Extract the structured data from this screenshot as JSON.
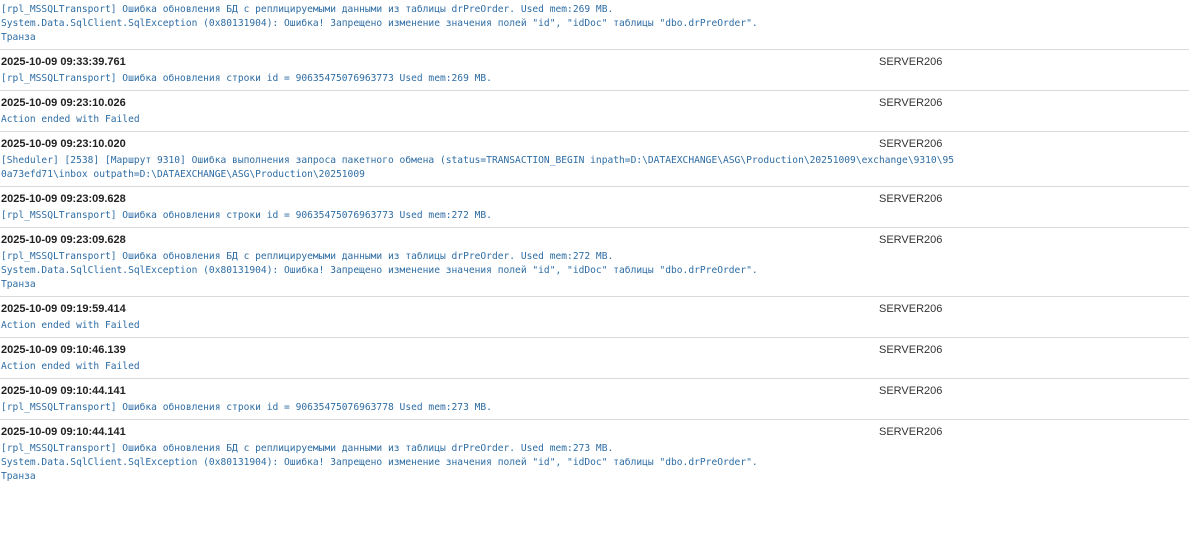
{
  "entries": [
    {
      "timestamp": "",
      "server": "",
      "lines": [
        "[rpl_MSSQLTransport] Ошибка обновления БД с реплицируемыми данными из таблицы drPreOrder. Used mem:269 MB.",
        "System.Data.SqlClient.SqlException (0x80131904): Ошибка! Запрещено изменение значения полей \"id\", \"idDoc\" таблицы \"dbo.drPreOrder\".",
        "Транза"
      ]
    },
    {
      "timestamp": "2025-10-09 09:33:39.761",
      "server": "SERVER206",
      "lines": [
        "[rpl_MSSQLTransport] Ошибка обновления строки id = 90635475076963773 Used mem:269 MB."
      ]
    },
    {
      "timestamp": "2025-10-09 09:23:10.026",
      "server": "SERVER206",
      "lines": [
        "Action ended with Failed"
      ]
    },
    {
      "timestamp": "2025-10-09 09:23:10.020",
      "server": "SERVER206",
      "lines": [
        "[Sheduler] [2538] [Маршрут 9310] Ошибка выполнения запроса пакетного обмена (status=TRANSACTION_BEGIN inpath=D:\\DATAEXCHANGE\\ASG\\Production\\20251009\\exchange\\9310\\95",
        "0a73efd71\\inbox outpath=D:\\DATAEXCHANGE\\ASG\\Production\\20251009"
      ]
    },
    {
      "timestamp": "2025-10-09 09:23:09.628",
      "server": "SERVER206",
      "lines": [
        "[rpl_MSSQLTransport] Ошибка обновления строки id = 90635475076963773 Used mem:272 MB."
      ]
    },
    {
      "timestamp": "2025-10-09 09:23:09.628",
      "server": "SERVER206",
      "lines": [
        "[rpl_MSSQLTransport] Ошибка обновления БД с реплицируемыми данными из таблицы drPreOrder. Used mem:272 MB.",
        "System.Data.SqlClient.SqlException (0x80131904): Ошибка! Запрещено изменение значения полей \"id\", \"idDoc\" таблицы \"dbo.drPreOrder\".",
        "Транза"
      ]
    },
    {
      "timestamp": "2025-10-09 09:19:59.414",
      "server": "SERVER206",
      "lines": [
        "Action ended with Failed"
      ]
    },
    {
      "timestamp": "2025-10-09 09:10:46.139",
      "server": "SERVER206",
      "lines": [
        "Action ended with Failed"
      ]
    },
    {
      "timestamp": "2025-10-09 09:10:44.141",
      "server": "SERVER206",
      "lines": [
        "[rpl_MSSQLTransport] Ошибка обновления строки id = 90635475076963778 Used mem:273 MB."
      ]
    },
    {
      "timestamp": "2025-10-09 09:10:44.141",
      "server": "SERVER206",
      "lines": [
        "[rpl_MSSQLTransport] Ошибка обновления БД с реплицируемыми данными из таблицы drPreOrder. Used mem:273 MB.",
        "System.Data.SqlClient.SqlException (0x80131904): Ошибка! Запрещено изменение значения полей \"id\", \"idDoc\" таблицы \"dbo.drPreOrder\".",
        "Транза"
      ]
    }
  ],
  "colors": {
    "message": "#2e6da4",
    "timestamp": "#222222",
    "separator": "#d9d9d9"
  }
}
